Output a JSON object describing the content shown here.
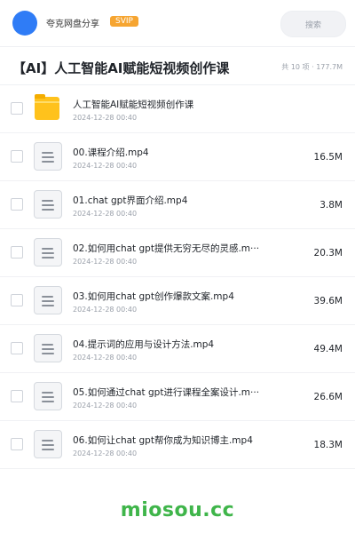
{
  "header": {
    "site_name": "夸克网盘分享",
    "badge": "SVIP",
    "search_placeholder": "搜索"
  },
  "title": {
    "text": "【AI】人工智能AI赋能短视频创作课",
    "summary": "共 10 项 · 177.7M"
  },
  "files": [
    {
      "name": "人工智能AI赋能短视频创作课",
      "date": "2024-12-28 00:40",
      "size": "",
      "type": "folder"
    },
    {
      "name": "00.课程介绍.mp4",
      "date": "2024-12-28 00:40",
      "size": "16.5M",
      "type": "file"
    },
    {
      "name": "01.chat gpt界面介绍.mp4",
      "date": "2024-12-28 00:40",
      "size": "3.8M",
      "type": "file"
    },
    {
      "name": "02.如何用chat gpt提供无穷无尽的灵感.m···",
      "date": "2024-12-28 00:40",
      "size": "20.3M",
      "type": "file"
    },
    {
      "name": "03.如何用chat gpt创作爆款文案.mp4",
      "date": "2024-12-28 00:40",
      "size": "39.6M",
      "type": "file"
    },
    {
      "name": "04.提示词的应用与设计方法.mp4",
      "date": "2024-12-28 00:40",
      "size": "49.4M",
      "type": "file"
    },
    {
      "name": "05.如何通过chat gpt进行课程全案设计.m···",
      "date": "2024-12-28 00:40",
      "size": "26.6M",
      "type": "file"
    },
    {
      "name": "06.如何让chat gpt帮你成为知识博主.mp4",
      "date": "2024-12-28 00:40",
      "size": "18.3M",
      "type": "file"
    }
  ],
  "watermark": "miosou.cc",
  "colors": {
    "avatar": "#2f7cf6",
    "badge": "#f6a531",
    "folder": "#ffc21c",
    "watermark": "#3fb54a"
  }
}
